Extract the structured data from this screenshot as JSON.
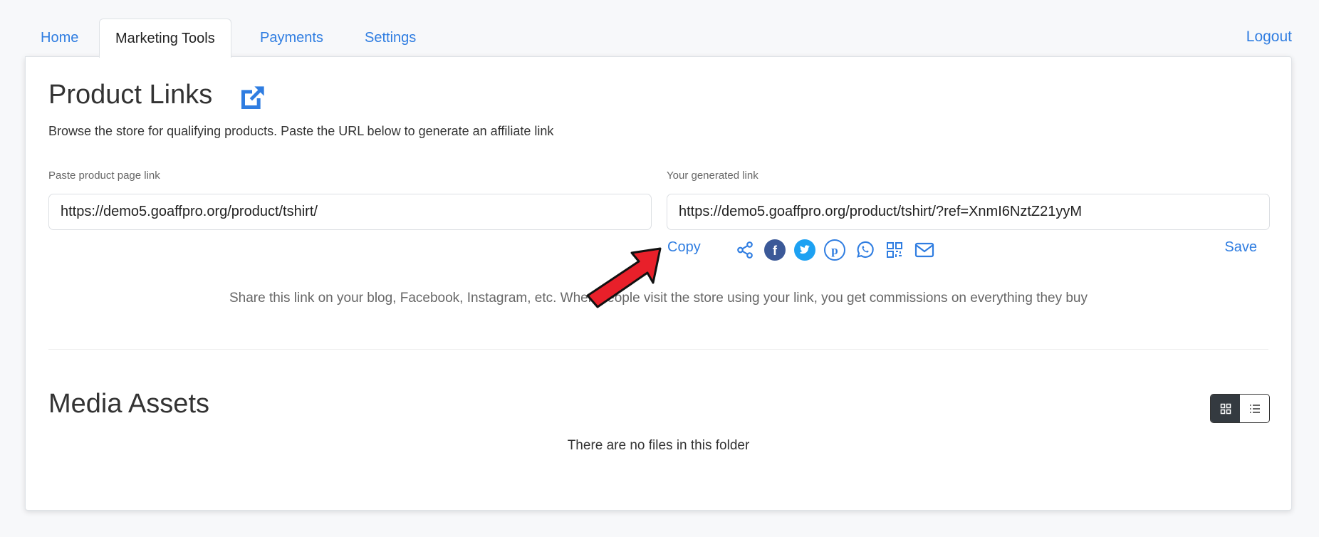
{
  "tabs": [
    {
      "label": "Home"
    },
    {
      "label": "Marketing Tools",
      "active": true
    },
    {
      "label": "Payments"
    },
    {
      "label": "Settings"
    }
  ],
  "logout": "Logout",
  "product_links": {
    "title": "Product Links",
    "subtitle": "Browse the store for qualifying products. Paste the URL below to generate an affiliate link",
    "paste_label": "Paste product page link",
    "paste_value": "https://demo5.goaffpro.org/product/tshirt/",
    "generated_label": "Your generated link",
    "generated_value": "https://demo5.goaffpro.org/product/tshirt/?ref=XnmI6NztZ21yyM",
    "copy": "Copy",
    "save": "Save",
    "share_icons": [
      "share-icon",
      "facebook-icon",
      "twitter-icon",
      "pinterest-icon",
      "whatsapp-icon",
      "qr-code-icon",
      "email-icon"
    ],
    "share_text": "Share this link on your blog, Facebook, Instagram, etc. When people visit the store using your link, you get commissions on everything they buy"
  },
  "media_assets": {
    "title": "Media Assets",
    "empty": "There are no files in this folder",
    "view": "grid"
  },
  "colors": {
    "accent": "#2f7de1",
    "facebook": "#3b5998",
    "twitter": "#1da1f2",
    "arrow": "#e8202a"
  }
}
